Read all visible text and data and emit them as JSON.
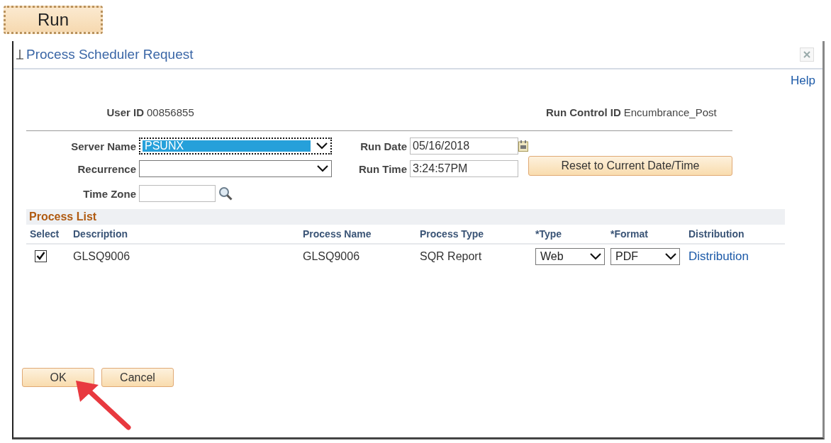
{
  "run_button": {
    "label": "Run"
  },
  "dialog": {
    "title": "Process Scheduler Request",
    "help_link": "Help",
    "user_id": {
      "label": "User ID",
      "value": "00856855"
    },
    "run_control_id": {
      "label": "Run Control ID",
      "value": "Encumbrance_Post"
    },
    "server_name": {
      "label": "Server Name",
      "value": "PSUNX",
      "focused": true
    },
    "recurrence": {
      "label": "Recurrence",
      "focused": false
    },
    "time_zone": {
      "label": "Time Zone"
    },
    "run_date": {
      "label": "Run Date",
      "value": "05/16/2018"
    },
    "run_time": {
      "label": "Run Time",
      "value": "3:24:57PM"
    },
    "reset_button": "Reset to Current Date/Time",
    "process_list": {
      "title": "Process List",
      "columns": [
        "Select",
        "Description",
        "Process Name",
        "Process Type",
        "*Type",
        "*Format",
        "Distribution"
      ],
      "rows": [
        {
          "checked": true,
          "description": "GLSQ9006",
          "process_name": "GLSQ9006",
          "process_type": "SQR Report",
          "type": "Web",
          "format": "PDF",
          "distribution": "Distribution"
        }
      ]
    },
    "buttons": [
      "OK",
      "Cancel"
    ]
  }
}
